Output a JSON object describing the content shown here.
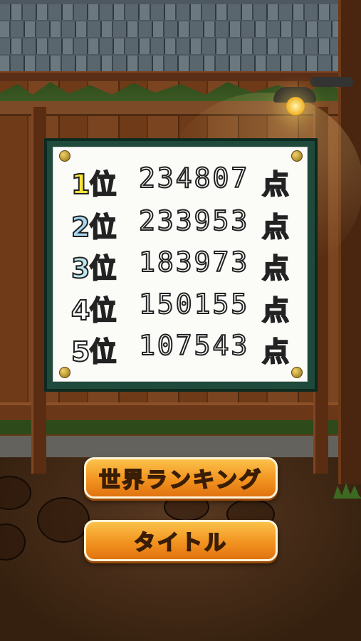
{
  "leaderboard": {
    "entries": [
      {
        "rank": "1位",
        "score": "234807",
        "unit": "点",
        "color": "#f6e33a"
      },
      {
        "rank": "2位",
        "score": "233953",
        "unit": "点",
        "color": "#a9d7f0"
      },
      {
        "rank": "3位",
        "score": "183973",
        "unit": "点",
        "color": "#bde8f0"
      },
      {
        "rank": "4位",
        "score": "150155",
        "unit": "点",
        "color": "#ffffff"
      },
      {
        "rank": "5位",
        "score": "107543",
        "unit": "点",
        "color": "#ffffff"
      }
    ]
  },
  "buttons": {
    "world_ranking_label": "世界ランキング",
    "title_label": "タイトル",
    "accent_color": "#f29320"
  },
  "scene_icons": [
    "lamp-icon",
    "pin-icon",
    "grass-tuft-icon"
  ]
}
